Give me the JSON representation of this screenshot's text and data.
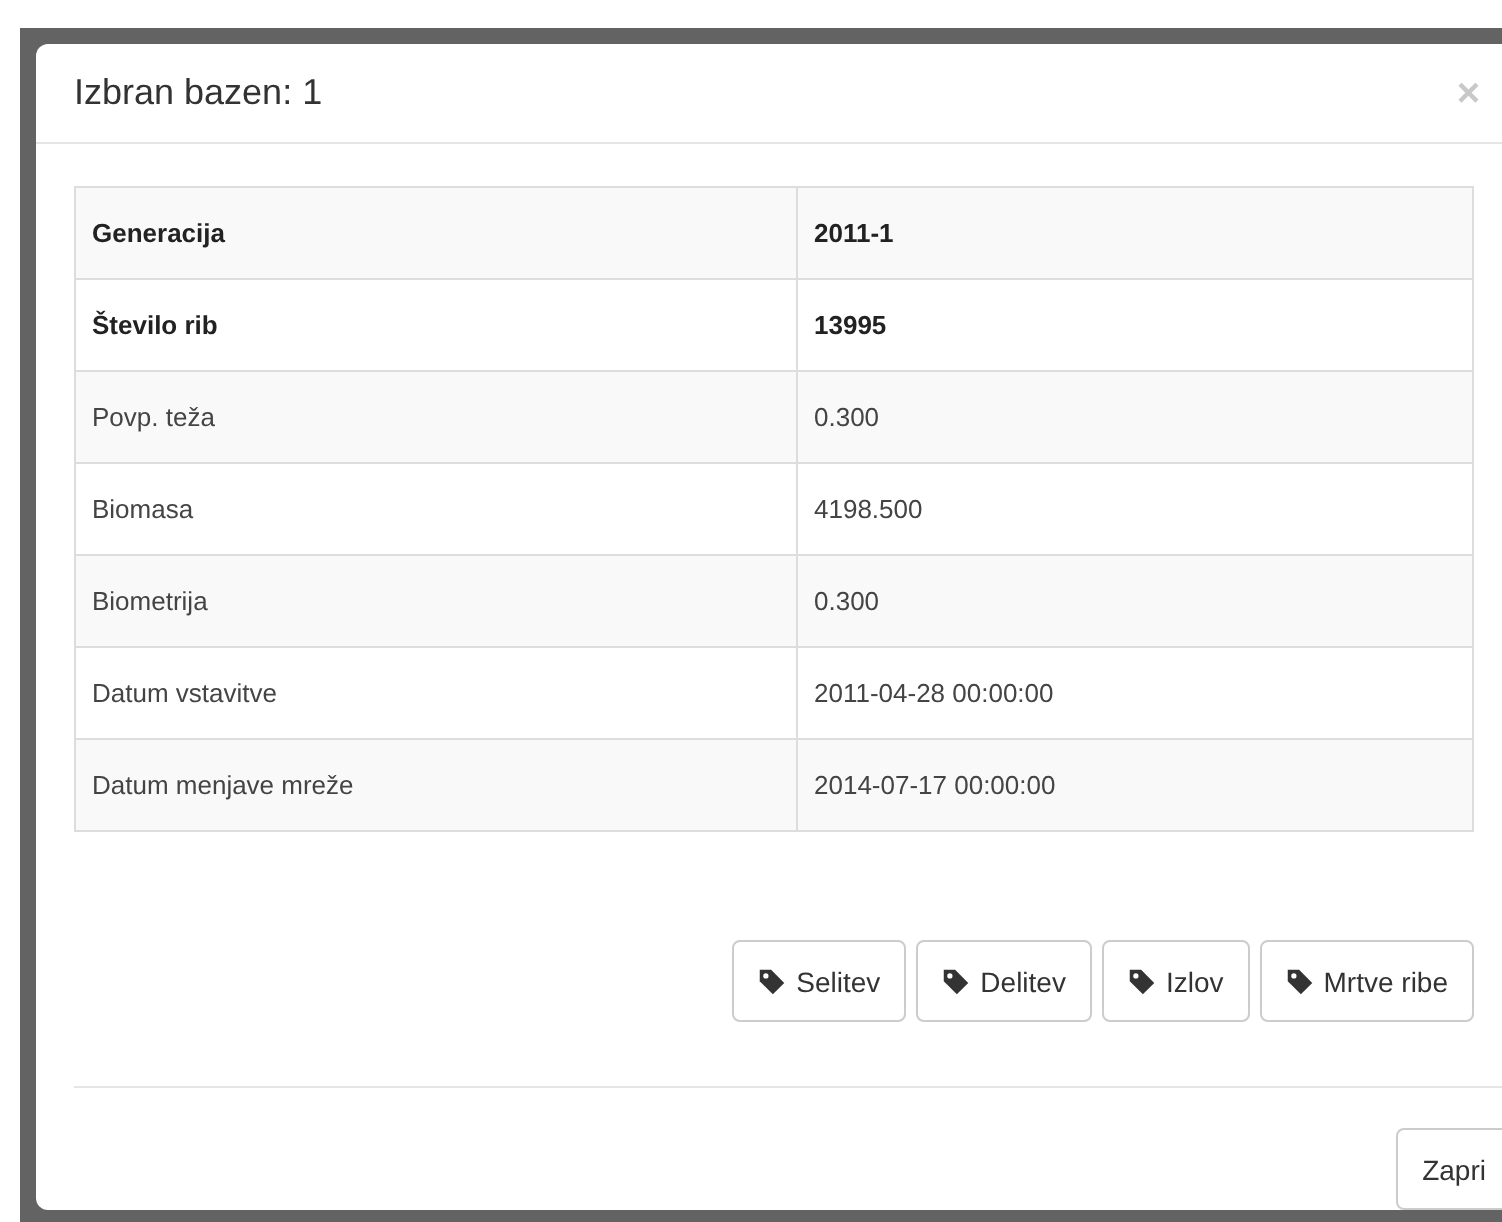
{
  "modal": {
    "title": "Izbran bazen: 1",
    "close": "×"
  },
  "table": {
    "rows": [
      {
        "label": "Generacija",
        "value": "2011-1",
        "emphasized": true
      },
      {
        "label": "Število rib",
        "value": "13995",
        "emphasized": true
      },
      {
        "label": "Povp. teža",
        "value": "0.300",
        "emphasized": false
      },
      {
        "label": "Biomasa",
        "value": "4198.500",
        "emphasized": false
      },
      {
        "label": "Biometrija",
        "value": "0.300",
        "emphasized": false
      },
      {
        "label": "Datum vstavitve",
        "value": "2011-04-28 00:00:00",
        "emphasized": false
      },
      {
        "label": "Datum menjave mreže",
        "value": "2014-07-17 00:00:00",
        "emphasized": false
      }
    ]
  },
  "actions": [
    "Selitev",
    "Delitev",
    "Izlov",
    "Mrtve ribe"
  ],
  "footer": {
    "button": "Zapri"
  }
}
